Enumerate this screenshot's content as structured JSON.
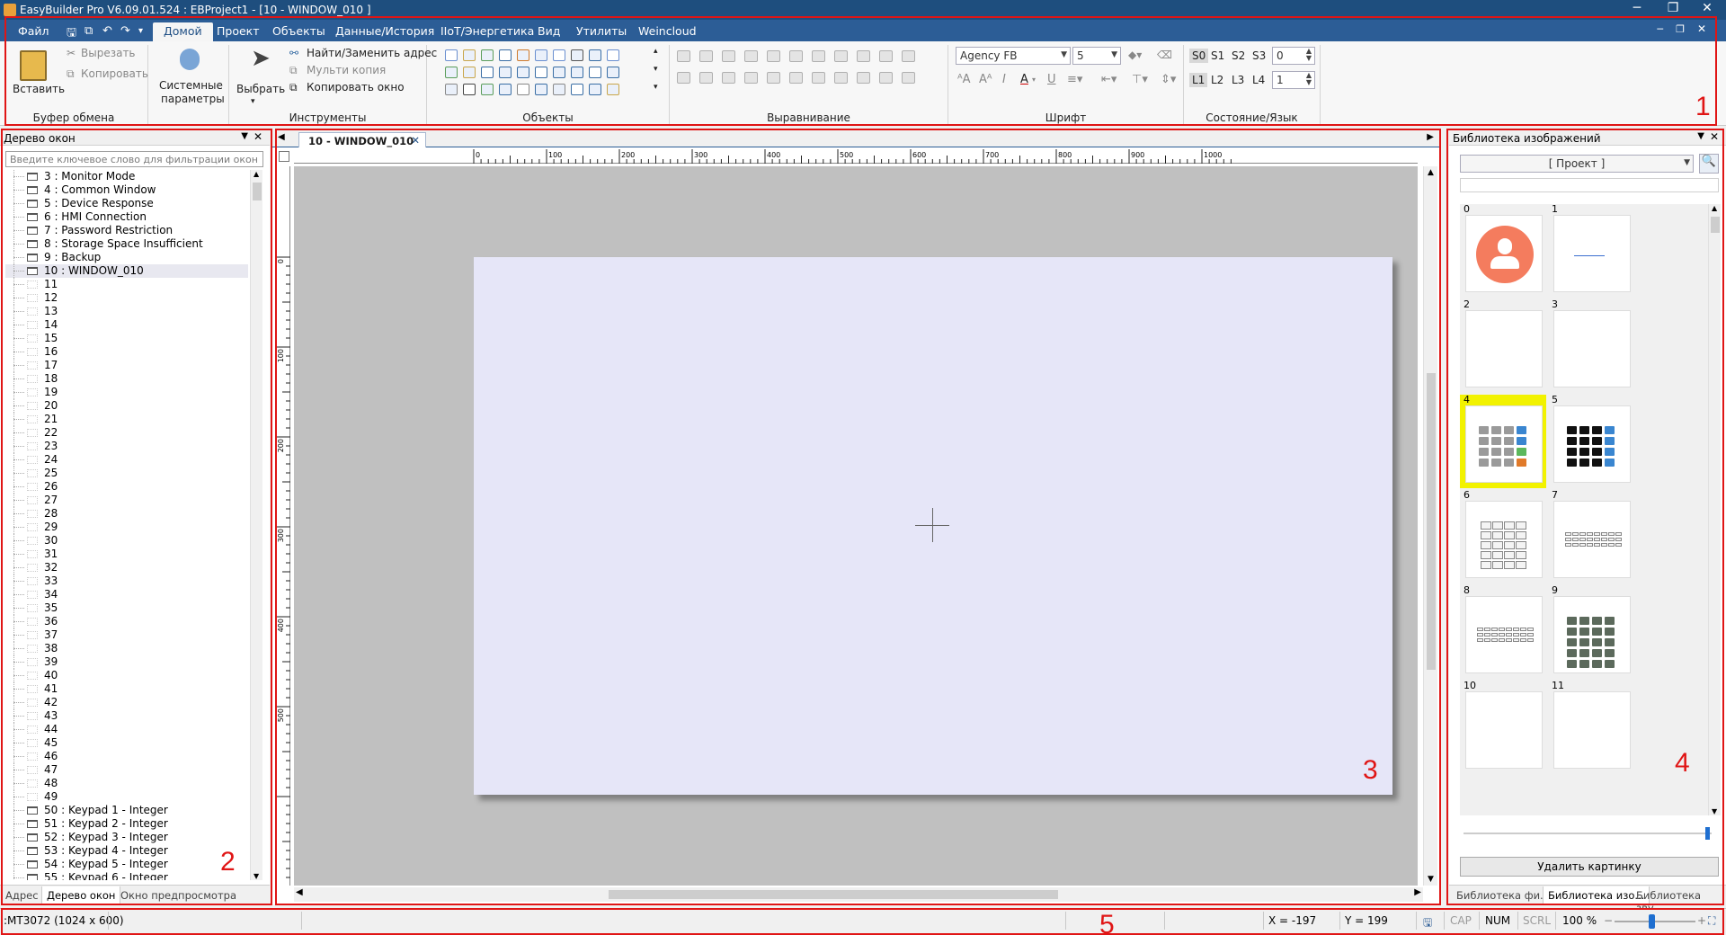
{
  "window": {
    "title": "EasyBuilder Pro V6.09.01.524 : EBProject1 - [10 - WINDOW_010 ]"
  },
  "menu": {
    "items": [
      "Файл",
      "Домой",
      "Проект",
      "Объекты",
      "Данные/История",
      "IIoT/Энергетика",
      "Вид",
      "Утилиты",
      "Weincloud"
    ],
    "active": "Домой"
  },
  "ribbon": {
    "clipboard": {
      "label": "Буфер обмена",
      "paste": "Вставить",
      "cut": "Вырезать",
      "copy": "Копировать"
    },
    "system": {
      "line1": "Системные",
      "line2": "параметры"
    },
    "tools": {
      "label": "Инструменты",
      "select": "Выбрать",
      "find_replace": "Найти/Заменить адрес",
      "multi_copy": "Мульти копия",
      "copy_window": "Копировать окно"
    },
    "objects": {
      "label": "Объекты"
    },
    "alignment": {
      "label": "Выравнивание"
    },
    "font": {
      "label": "Шрифт",
      "family": "Agency FB",
      "size": "5"
    },
    "state": {
      "label": "Состояние/Язык",
      "states": [
        "S0",
        "S1",
        "S2",
        "S3"
      ],
      "state_value": "0",
      "langs": [
        "L1",
        "L2",
        "L3",
        "L4"
      ],
      "lang_value": "1"
    }
  },
  "left_panel": {
    "title": "Дерево окон",
    "filter_placeholder": "Введите ключевое слово для фильтрации окон",
    "selected": "10 : WINDOW_010",
    "items": [
      "3 : Monitor Mode",
      "4 : Common Window",
      "5 : Device Response",
      "6 : HMI Connection",
      "7 : Password Restriction",
      "8 : Storage Space Insufficient",
      "9 : Backup",
      "10 : WINDOW_010",
      "11",
      "12",
      "13",
      "14",
      "15",
      "16",
      "17",
      "18",
      "19",
      "20",
      "21",
      "22",
      "23",
      "24",
      "25",
      "26",
      "27",
      "28",
      "29",
      "30",
      "31",
      "32",
      "33",
      "34",
      "35",
      "36",
      "37",
      "38",
      "39",
      "40",
      "41",
      "42",
      "43",
      "44",
      "45",
      "46",
      "47",
      "48",
      "49",
      "50 : Keypad 1 - Integer",
      "51 : Keypad 2 - Integer",
      "52 : Keypad 3 - Integer",
      "53 : Keypad 4 - Integer",
      "54 : Keypad 5 - Integer",
      "55 : Keypad 6 - Integer"
    ],
    "tabs": [
      "Адрес",
      "Дерево окон",
      "Окно предпросмотра"
    ],
    "active_tab": "Дерево окон"
  },
  "editor": {
    "tab_label": "10 - WINDOW_010",
    "ruler_h": [
      "0",
      "100",
      "200",
      "300",
      "400",
      "500",
      "600",
      "700",
      "800",
      "900",
      "1000"
    ],
    "ruler_v": [
      "0",
      "100",
      "200",
      "300",
      "400",
      "500"
    ]
  },
  "right_panel": {
    "title": "Библиотека изображений",
    "source": "[ Проект ]",
    "cells": [
      "0",
      "1",
      "2",
      "3",
      "4",
      "5",
      "6",
      "7",
      "8",
      "9",
      "10",
      "11"
    ],
    "selected_cell": "4",
    "delete_button": "Удалить картинку",
    "tabs": [
      "Библиотека фи...",
      "Библиотека изо...",
      "Библиотека зву..."
    ],
    "active_tab": "Библиотека изо..."
  },
  "status": {
    "model": ":MT3072 (1024 x 600)",
    "x": "X = -197",
    "y": "Y = 199",
    "cap": "CAP",
    "num": "NUM",
    "scrl": "SCRL",
    "zoom": "100 %"
  },
  "annotations": [
    "1",
    "2",
    "3",
    "4",
    "5"
  ],
  "colors": {
    "annotation": "#e01515",
    "titlebar": "#1e4e7e",
    "menubar": "#2c5d96",
    "canvas": "#e6e6f8",
    "workspace": "#c0c0c0",
    "selection": "#f2f200",
    "avatar": "#f47c5e"
  }
}
